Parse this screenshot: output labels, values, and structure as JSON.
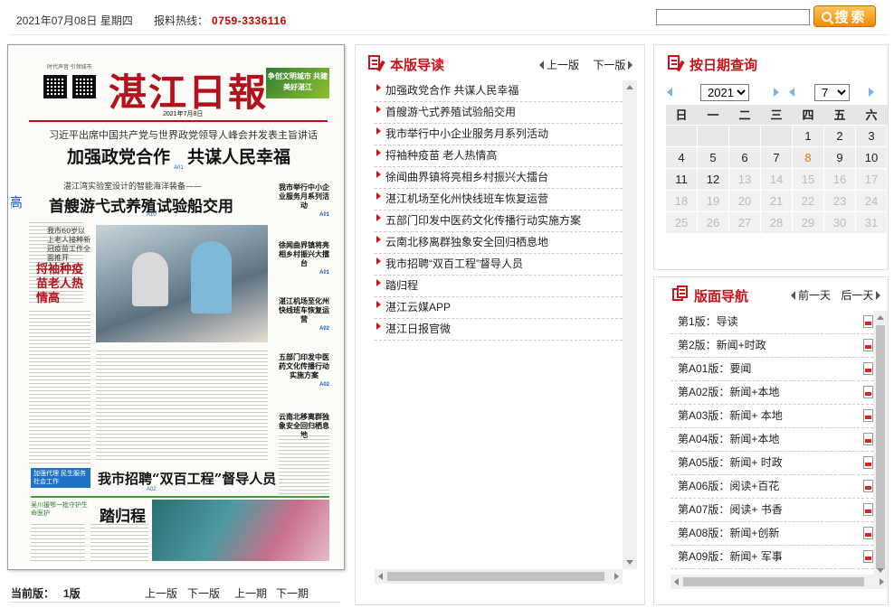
{
  "topbar": {
    "date": "2021年07月08日 星期四",
    "hotline_label": "报料热线：",
    "hotline_number": "0759-3336116",
    "search_value": "",
    "search_button": "搜索"
  },
  "paper": {
    "masthead": "湛江日報",
    "promo": "争创文明城市 共建美好湛江",
    "masthead_side": "时代声音 引领城市",
    "date_line": "2021年7月8日",
    "subhead1": "习近平出席中国共产党与世界政党领导人峰会并发表主旨讲话",
    "headline1": "加强政党合作　共谋人民幸福",
    "ref1": "A01",
    "subhead2": "湛江湾实验室设计的智能海洋装备——",
    "headline2": "首艘游弋式养殖试验船交用",
    "ref2": "A10",
    "side_label": "高",
    "red_head": "捋袖种疫苗老人热情高",
    "red_sub": "我市60岁以上老人接种新冠疫苗工作全面推开",
    "side_items": [
      {
        "text": "我市举行中小企业服务月系列活动",
        "ref": "A01"
      },
      {
        "text": "徐闻曲界镇将亮相乡村振兴大擂台",
        "ref": "A01"
      },
      {
        "text": "湛江机场至化州快线班车恢复运营",
        "ref": "A02"
      },
      {
        "text": "五部门印发中医药文化传播行动实施方案",
        "ref": "A02"
      },
      {
        "text": "云南北移离群独象安全回归栖息地",
        "ref": ""
      }
    ],
    "blue_tag": "加强代理 民生服务社会工作",
    "headline3": "我市招聘“双百工程”督导人员",
    "ref3": "A02",
    "headline4": "踏归程",
    "green_tag": "吴川援鄂一批守护生命医护"
  },
  "left_footer": {
    "current_label": "当前版：",
    "current_value": "1版",
    "prev_page": "上一版",
    "next_page": "下一版",
    "prev_issue": "上一期",
    "next_issue": "下一期"
  },
  "guide": {
    "title": "本版导读",
    "prev": "上一版",
    "next": "下一版",
    "articles": [
      "加强政党合作 共谋人民幸福",
      "首艘游弋式养殖试验船交用",
      "我市举行中小企业服务月系列活动",
      "捋袖种疫苗 老人热情高",
      "徐闻曲界镇将亮相乡村振兴大擂台",
      "湛江机场至化州快线班车恢复运营",
      "五部门印发中医药文化传播行动实施方案",
      "云南北移离群独象安全回归栖息地",
      "我市招聘“双百工程”督导人员",
      "踏归程",
      "湛江云媒APP",
      "湛江日报官微"
    ]
  },
  "calendar": {
    "title": "按日期查询",
    "year": "2021",
    "month": "7",
    "weekdays": [
      "日",
      "一",
      "二",
      "三",
      "四",
      "五",
      "六"
    ],
    "weeks": [
      [
        "",
        "",
        "",
        "",
        "1",
        "2",
        "3"
      ],
      [
        "4",
        "5",
        "6",
        "7",
        "8",
        "9",
        "10"
      ],
      [
        "11",
        "12",
        "13",
        "14",
        "15",
        "16",
        "17"
      ],
      [
        "18",
        "19",
        "20",
        "21",
        "22",
        "23",
        "24"
      ],
      [
        "25",
        "26",
        "27",
        "28",
        "29",
        "30",
        "31"
      ]
    ],
    "today": "8",
    "last_active": "12",
    "today_color": "#e07b1c"
  },
  "pages_nav": {
    "title": "版面导航",
    "prev": "前一天",
    "next": "后一天",
    "pages": [
      "第1版：导读",
      "第2版：新闻+时政",
      "第A01版：要闻",
      "第A02版：新闻+本地",
      "第A03版：新闻+ 本地",
      "第A04版：新闻+本地",
      "第A05版：新闻+ 时政",
      "第A06版：阅读+百花",
      "第A07版：阅读+ 书香",
      "第A08版：新闻+创新",
      "第A09版：新闻+ 军事"
    ]
  },
  "colors": {
    "accent_red": "#c8141a",
    "hotline_red": "#cc0000",
    "search_orange": "#f08a00"
  }
}
